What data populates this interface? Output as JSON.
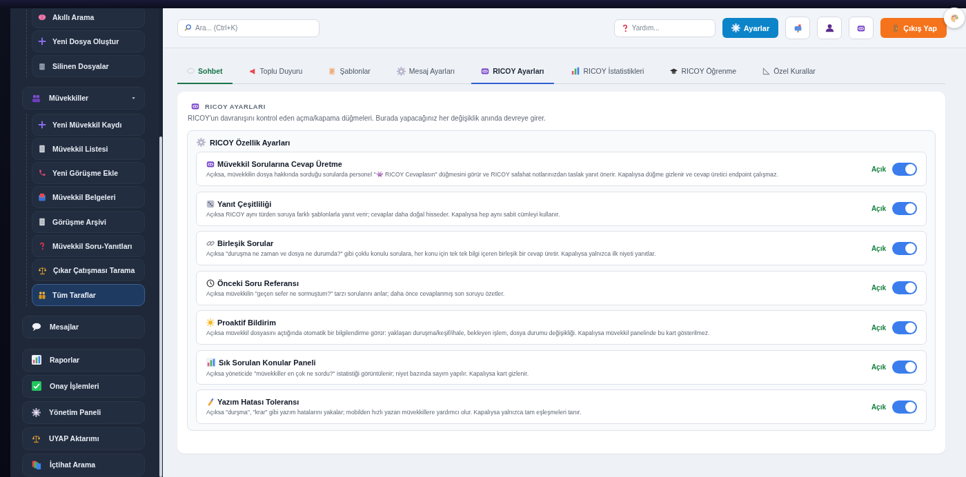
{
  "sidebar": {
    "sections": [
      {
        "items": [
          {
            "children": [
              {
                "label": "Akıllı Arama",
                "selected": false
              },
              {
                "label": "Yeni Dosya Oluştur",
                "selected": false
              },
              {
                "label": "Silinen Dosyalar",
                "selected": false
              }
            ]
          },
          {
            "label": "Müvekkiller",
            "selected": false,
            "expanded": true,
            "children": [
              {
                "label": "Yeni Müvekkil Kaydı",
                "selected": false
              },
              {
                "label": "Müvekkil Listesi",
                "selected": false
              },
              {
                "label": "Yeni Görüşme Ekle",
                "selected": false
              },
              {
                "label": "Müvekkil Belgeleri",
                "selected": false
              },
              {
                "label": "Görüşme Arşivi",
                "selected": false
              },
              {
                "label": "Müvekkil Soru-Yanıtları",
                "selected": false
              },
              {
                "label": "Çıkar Çatışması Tarama",
                "selected": false
              },
              {
                "label": "Tüm Taraflar",
                "selected": true
              }
            ]
          },
          {
            "label": "Mesajlar",
            "selected": false
          }
        ]
      },
      {
        "items": [
          {
            "label": "Raporlar",
            "selected": false
          },
          {
            "label": "Onay İşlemleri",
            "selected": false
          },
          {
            "label": "Yönetim Paneli",
            "selected": false
          },
          {
            "label": "UYAP Aktarımı",
            "selected": false
          },
          {
            "label": "İçtihat Arama",
            "selected": false
          }
        ]
      }
    ]
  },
  "topbar": {
    "search": {
      "placeholder": "Ara... (Ctrl+K)"
    },
    "help": {
      "placeholder": "Yardım..."
    },
    "settings_button": "Ayarlar",
    "logout_button": "Çıkış Yap"
  },
  "tabs": [
    {
      "label": "Sohbet",
      "selected": false,
      "primary": true
    },
    {
      "label": "Toplu Duyuru",
      "selected": false,
      "primary": false
    },
    {
      "label": "Şablonlar",
      "selected": false,
      "primary": false
    },
    {
      "label": "Mesaj Ayarları",
      "selected": false,
      "primary": false
    },
    {
      "label": "RICOY Ayarları",
      "selected": true,
      "primary": false
    },
    {
      "label": "RICOY İstatistikleri",
      "selected": false,
      "primary": false
    },
    {
      "label": "RICOY Öğrenme",
      "selected": false,
      "primary": false
    },
    {
      "label": "Özel Kurallar",
      "selected": false,
      "primary": false
    }
  ],
  "panel": {
    "title": "RICOY AYARLARI",
    "intro": "RICOY'un davranışını kontrol eden açma/kapama düğmeleri. Burada yapacağınız her değişiklik anında devreye girer.",
    "group_title": "RICOY Özellik Ayarları",
    "settings": [
      {
        "title": "Müvekkil Sorularına Cevap Üretme",
        "description": "Açıksa, müvekkilin dosya hakkında sorduğu sorularda personel \"👾 RICOY Cevaplasın\" düğmesini görür ve RICOY safahat notlarınızdan taslak yanıt önerir. Kapalıysa düğme gizlenir ve cevap üretici endpoint çalışmaz.",
        "on": true,
        "state_label": "Açık"
      },
      {
        "title": "Yanıt Çeşitliliği",
        "description": "Açıksa RICOY aynı türden soruya farklı şablonlarla yanıt verir; cevaplar daha doğal hisseder. Kapalıysa hep aynı sabit cümleyi kullanır.",
        "on": true,
        "state_label": "Açık"
      },
      {
        "title": "Birleşik Sorular",
        "description": "Açıksa \"duruşma ne zaman ve dosya ne durumda?\" gibi çoklu konulu sorulara, her konu için tek tek bilgi içeren birleşik bir cevap üretir. Kapalıysa yalnızca ilk niyeti yanıtlar.",
        "on": true,
        "state_label": "Açık"
      },
      {
        "title": "Önceki Soru Referansı",
        "description": "Açıksa müvekkilin \"geçen sefer ne sormuştum?\" tarzı sorularını anlar; daha önce cevaplanmış son soruyu özetler.",
        "on": true,
        "state_label": "Açık"
      },
      {
        "title": "Proaktif Bildirim",
        "description": "Açıksa müvekkil dosyasını açtığında otomatik bir bilgilendirme görür: yaklaşan duruşma/keşif/ihale, bekleyen işlem, dosya durumu değişikliği. Kapalıysa müvekkil panelinde bu kart gösterilmez.",
        "on": true,
        "state_label": "Açık"
      },
      {
        "title": "Sık Sorulan Konular Paneli",
        "description": "Açıksa yöneticide \"müvekkiller en çok ne sordu?\" istatistiği görüntülenir; niyet bazında sayım yapılır. Kapalıysa kart gizlenir.",
        "on": true,
        "state_label": "Açık"
      },
      {
        "title": "Yazım Hatası Toleransı",
        "description": "Açıksa \"durşma\", \"krar\" gibi yazım hatalarını yakalar; mobilden hızlı yazan müvekkillere yardımcı olur. Kapalıysa yalnızca tam eşleşmeleri tanır.",
        "on": true,
        "state_label": "Açık"
      }
    ]
  }
}
